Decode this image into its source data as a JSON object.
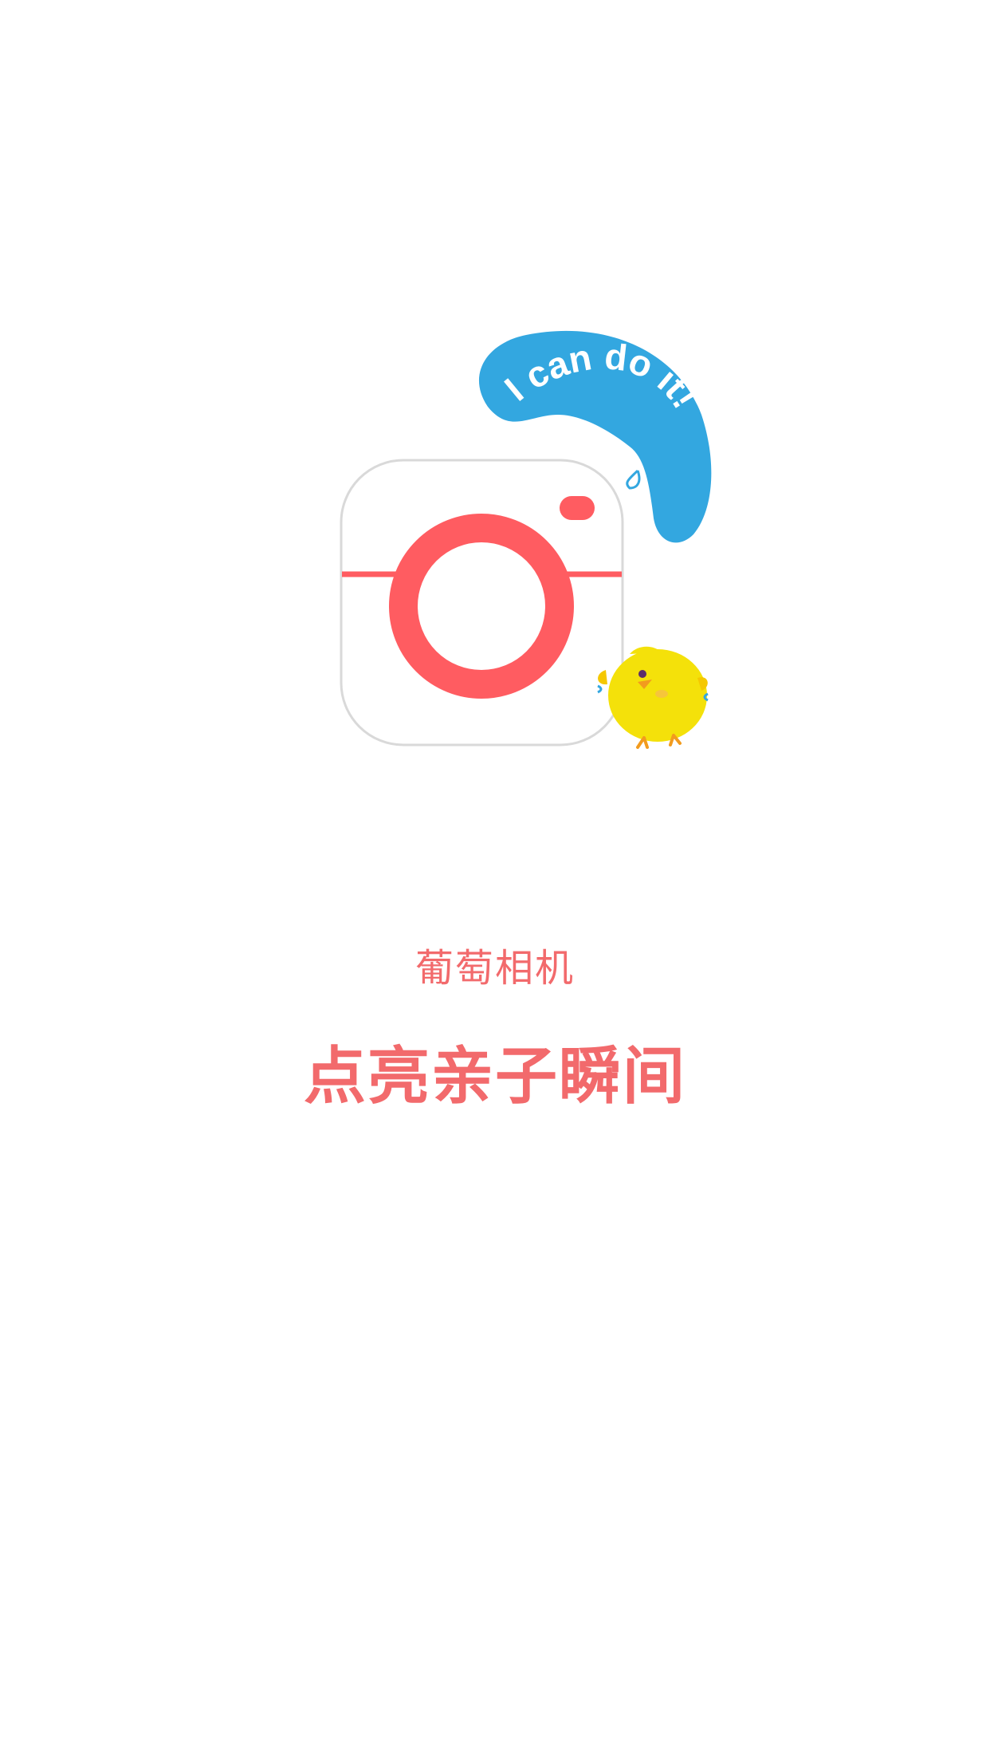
{
  "splash": {
    "bubble_text": "I can do it!",
    "app_name": "葡萄相机",
    "slogan": "点亮亲子瞬间"
  },
  "colors": {
    "background": "#ffffff",
    "brand_coral": "#f26a6c",
    "camera_red": "#ff5c61",
    "bubble_blue": "#33a7e0",
    "chick_yellow": "#f4e10a"
  },
  "icons": [
    "camera-app-icon",
    "speech-bubble",
    "chick-mascot"
  ]
}
